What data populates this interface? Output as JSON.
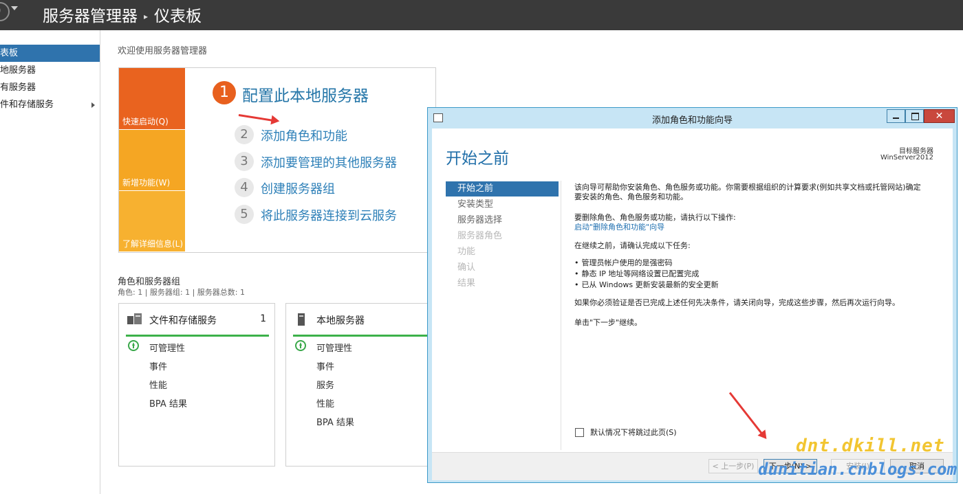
{
  "header": {
    "breadcrumb_app": "服务器管理器",
    "breadcrumb_sep": "▸",
    "breadcrumb_page": "仪表板"
  },
  "sidebar": {
    "items": [
      {
        "label": "仪表板"
      },
      {
        "label": "本地服务器"
      },
      {
        "label": "所有服务器"
      },
      {
        "label": "文件和存储服务"
      }
    ]
  },
  "welcome": {
    "title": "欢迎使用服务器管理器",
    "tiles": {
      "quick_start": "快速启动(Q)",
      "whats_new": "新增功能(W)",
      "learn_more": "了解详细信息(L)"
    },
    "steps": [
      {
        "num": "1",
        "label": "配置此本地服务器"
      },
      {
        "num": "2",
        "label": "添加角色和功能"
      },
      {
        "num": "3",
        "label": "添加要管理的其他服务器"
      },
      {
        "num": "4",
        "label": "创建服务器组"
      },
      {
        "num": "5",
        "label": "将此服务器连接到云服务"
      }
    ]
  },
  "roles": {
    "title": "角色和服务器组",
    "summary": "角色: 1 | 服务器组: 1 | 服务器总数: 1",
    "cards": [
      {
        "title": "文件和存储服务",
        "count": "1",
        "rows": [
          "可管理性",
          "事件",
          "性能",
          "BPA 结果"
        ]
      },
      {
        "title": "本地服务器",
        "count": "",
        "rows": [
          "可管理性",
          "事件",
          "服务",
          "性能",
          "BPA 结果"
        ]
      }
    ]
  },
  "wizard": {
    "title": "添加角色和功能向导",
    "close": "✕",
    "heading": "开始之前",
    "target_label": "目标服务器",
    "target_server": "WinServer2012",
    "nav": [
      {
        "label": "开始之前",
        "state": "current"
      },
      {
        "label": "安装类型",
        "state": "enabled"
      },
      {
        "label": "服务器选择",
        "state": "enabled"
      },
      {
        "label": "服务器角色",
        "state": "disabled"
      },
      {
        "label": "功能",
        "state": "disabled"
      },
      {
        "label": "确认",
        "state": "disabled"
      },
      {
        "label": "结果",
        "state": "disabled"
      }
    ],
    "intro_line1": "该向导可帮助你安装角色、角色服务或功能。你需要根据组织的计算要求(例如共享文档或托管网站)确定",
    "intro_line2": "要安装的角色、角色服务和功能。",
    "remove_text": "要删除角色、角色服务或功能，请执行以下操作:",
    "remove_link": "启动\"删除角色和功能\"向导",
    "before_text": "在继续之前，请确认完成以下任务:",
    "bullets": [
      "管理员帐户使用的是强密码",
      "静态 IP 地址等网络设置已配置完成",
      "已从 Windows 更新安装最新的安全更新"
    ],
    "verify_text": "如果你必须验证是否已完成上述任何先决条件，请关闭向导，完成这些步骤，然后再次运行向导。",
    "continue_text": "单击\"下一步\"继续。",
    "skip_label": "默认情况下将跳过此页(S)",
    "buttons": {
      "prev": "< 上一步(P)",
      "next": "下一步(N) >",
      "install": "安装(I)",
      "cancel": "取消"
    }
  },
  "watermarks": {
    "line1": "dnt.dkill.net",
    "line2": "dunitian.cnblogs.com"
  },
  "colors": {
    "topbar": "#3a3a3a",
    "accent_blue": "#2f73ad",
    "quick_start_tile": "#e9631f",
    "whats_new_tile": "#f5a623",
    "learn_more_tile": "#f7b130",
    "health_green": "#3cb14a",
    "annotation_arrow": "#e53935"
  }
}
